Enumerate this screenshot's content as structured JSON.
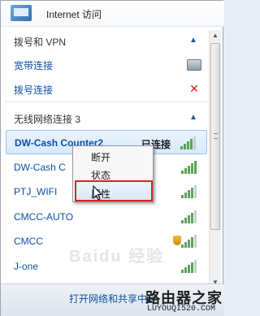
{
  "header": {
    "internet_label": "Internet 访问"
  },
  "dialup": {
    "title": "拨号和 VPN",
    "items": [
      {
        "label": "宽带连接",
        "icon": "modem-icon"
      },
      {
        "label": "拨号连接",
        "icon": "disconnected-x-icon"
      }
    ]
  },
  "wireless": {
    "title": "无线网络连接 3",
    "networks": [
      {
        "name": "DW-Cash Counter2",
        "status": "已连接",
        "signal": 4,
        "secured": false
      },
      {
        "name": "DW-Cash C",
        "status": "",
        "signal": 5,
        "secured": false
      },
      {
        "name": "PTJ_WIFI",
        "status": "",
        "signal": 4,
        "secured": false
      },
      {
        "name": "CMCC-AUTO",
        "status": "",
        "signal": 4,
        "secured": false
      },
      {
        "name": "CMCC",
        "status": "",
        "signal": 4,
        "secured": true
      },
      {
        "name": "J-one",
        "status": "",
        "signal": 4,
        "secured": false
      }
    ]
  },
  "context_menu": {
    "items": [
      {
        "label": "断开"
      },
      {
        "label": "状态"
      },
      {
        "label": "属性"
      }
    ]
  },
  "footer": {
    "link": "打开网络和共享中心"
  },
  "watermark": "Baidu 经验",
  "brand": {
    "title": "路由器之家",
    "url": "LUYOUQI520.COM"
  },
  "colors": {
    "link": "#0f4fa8",
    "highlight_border": "#d42424",
    "signal_on": "#5aa55a"
  }
}
